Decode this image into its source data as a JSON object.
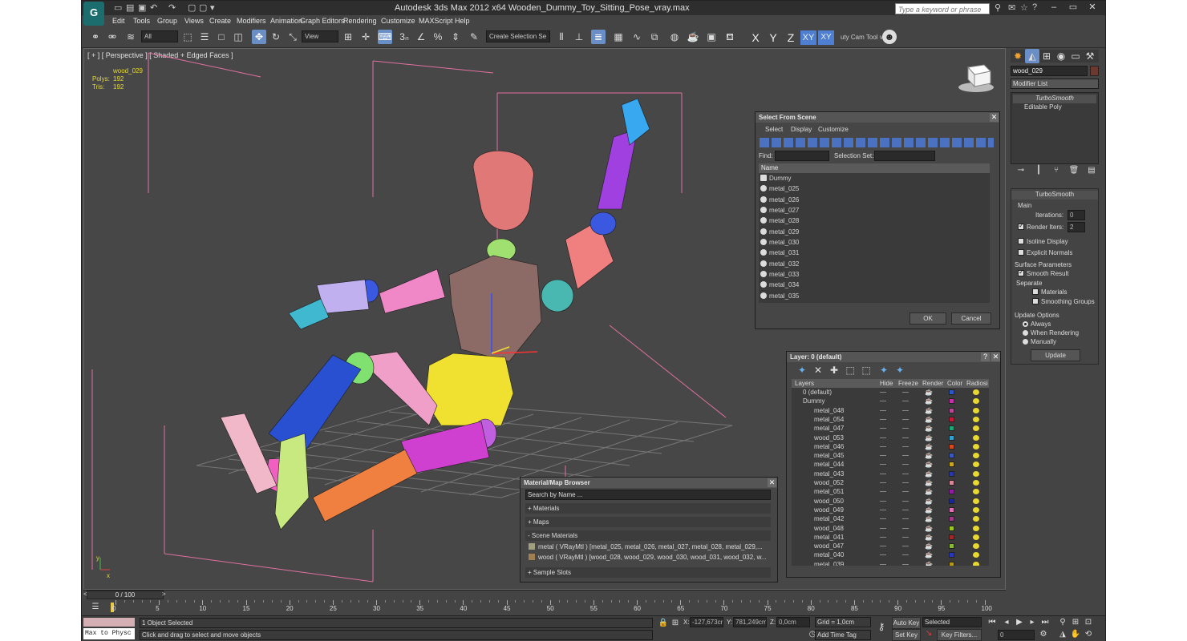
{
  "window": {
    "title": "Autodesk 3ds Max  2012 x64      Wooden_Dummy_Toy_Sitting_Pose_vray.max",
    "search_placeholder": "Type a keyword or phrase",
    "logo": "G"
  },
  "menu": [
    "Edit",
    "Tools",
    "Group",
    "Views",
    "Create",
    "Modifiers",
    "Animation",
    "Graph Editors",
    "Rendering",
    "Customize",
    "MAXScript",
    "Help"
  ],
  "toolbar": {
    "filter_all": "All",
    "ref_coord": "View",
    "selection_set": "Create Selection Se",
    "axis_x": "X",
    "axis_y": "Y",
    "axis_z": "Z",
    "axis_xy": "XY",
    "axis_xy2": "XY",
    "plugin_label": "uty Cam Tool v"
  },
  "viewport": {
    "label": "[ + ] [ Perspective ] [ Shaded + Edged Faces ]",
    "object_name": "wood_029",
    "polys_label": "Polys:",
    "polys_value": "192",
    "tris_label": "Tris:",
    "tris_value": "192"
  },
  "select_from_scene": {
    "title": "Select From Scene",
    "menus": [
      "Select",
      "Display",
      "Customize"
    ],
    "find_label": "Find:",
    "selection_set_label": "Selection Set:",
    "column_name": "Name",
    "items": [
      "Dummy",
      "metal_025",
      "metal_026",
      "metal_027",
      "metal_028",
      "metal_029",
      "metal_030",
      "metal_031",
      "metal_032",
      "metal_033",
      "metal_034",
      "metal_035"
    ],
    "ok": "OK",
    "cancel": "Cancel"
  },
  "layer_panel": {
    "title": "Layer: 0 (default)",
    "columns": [
      "Layers",
      "Hide",
      "Freeze",
      "Render",
      "Color",
      "Radiosi"
    ],
    "rows": [
      {
        "name": "0 (default)",
        "indent": 0,
        "color": "#2a58c8"
      },
      {
        "name": "Dummy",
        "indent": 0,
        "color": "#c830a8"
      },
      {
        "name": "metal_048",
        "indent": 1,
        "color": "#b84898"
      },
      {
        "name": "metal_054",
        "indent": 1,
        "color": "#c81838"
      },
      {
        "name": "metal_047",
        "indent": 1,
        "color": "#18a878"
      },
      {
        "name": "wood_053",
        "indent": 1,
        "color": "#30a0d0"
      },
      {
        "name": "metal_046",
        "indent": 1,
        "color": "#d84818"
      },
      {
        "name": "metal_045",
        "indent": 1,
        "color": "#3858c0"
      },
      {
        "name": "metal_044",
        "indent": 1,
        "color": "#c8a818"
      },
      {
        "name": "metal_043",
        "indent": 1,
        "color": "#2838a8"
      },
      {
        "name": "wood_052",
        "indent": 1,
        "color": "#d88898"
      },
      {
        "name": "metal_051",
        "indent": 1,
        "color": "#9818a8"
      },
      {
        "name": "wood_050",
        "indent": 1,
        "color": "#182898"
      },
      {
        "name": "wood_049",
        "indent": 1,
        "color": "#e070b8"
      },
      {
        "name": "metal_042",
        "indent": 1,
        "color": "#a03888"
      },
      {
        "name": "wood_048",
        "indent": 1,
        "color": "#98c818"
      },
      {
        "name": "metal_041",
        "indent": 1,
        "color": "#a02828"
      },
      {
        "name": "wood_047",
        "indent": 1,
        "color": "#88b838"
      },
      {
        "name": "metal_040",
        "indent": 1,
        "color": "#2838c0"
      },
      {
        "name": "metal_039",
        "indent": 1,
        "color": "#b89818"
      }
    ]
  },
  "material_browser": {
    "title": "Material/Map Browser",
    "search_placeholder": "Search by Name ...",
    "groups": [
      "+ Materials",
      "+ Maps",
      "- Scene Materials"
    ],
    "materials": [
      "metal  ( VRayMtl )  [metal_025, metal_026, metal_027, metal_028, metal_029,...",
      "wood  ( VRayMtl )  [wood_028, wood_029, wood_030, wood_031, wood_032, w..."
    ],
    "sample_slots": "+ Sample Slots"
  },
  "command_panel": {
    "object_name": "wood_029",
    "modifier_list": "Modifier List",
    "stack": [
      "TurboSmooth",
      "Editable Poly"
    ],
    "rollout_title": "TurboSmooth",
    "main_label": "Main",
    "iterations_label": "Iterations:",
    "iterations_value": "0",
    "render_iters_label": "Render Iters:",
    "render_iters_value": "2",
    "isoline_label": "Isoline Display",
    "explicit_normals_label": "Explicit Normals",
    "surface_params_label": "Surface Parameters",
    "smooth_result_label": "Smooth Result",
    "separate_label": "Separate",
    "materials_label": "Materials",
    "smoothing_groups_label": "Smoothing Groups",
    "update_options_label": "Update Options",
    "always_label": "Always",
    "when_rendering_label": "When Rendering",
    "manually_label": "Manually",
    "update_button": "Update"
  },
  "timeline": {
    "frame_label": "0 / 100",
    "ticks": [
      "0",
      "5",
      "10",
      "15",
      "20",
      "25",
      "30",
      "35",
      "40",
      "45",
      "50",
      "55",
      "60",
      "65",
      "70",
      "75",
      "80",
      "85",
      "90",
      "95",
      "100"
    ]
  },
  "status": {
    "maxscript": "Max to Physc",
    "selected_text": "1 Object Selected",
    "prompt_text": "Click and drag to select and move objects",
    "x_label": "X:",
    "x_value": "-127,673cr",
    "y_label": "Y:",
    "y_value": "781,249cm",
    "z_label": "Z:",
    "z_value": "0,0cm",
    "grid": "Grid = 1,0cm",
    "add_time_tag": "Add Time Tag",
    "auto_key": "Auto Key",
    "set_key": "Set Key",
    "selected_dropdown": "Selected",
    "key_filters": "Key Filters...",
    "frame_value": "0"
  }
}
